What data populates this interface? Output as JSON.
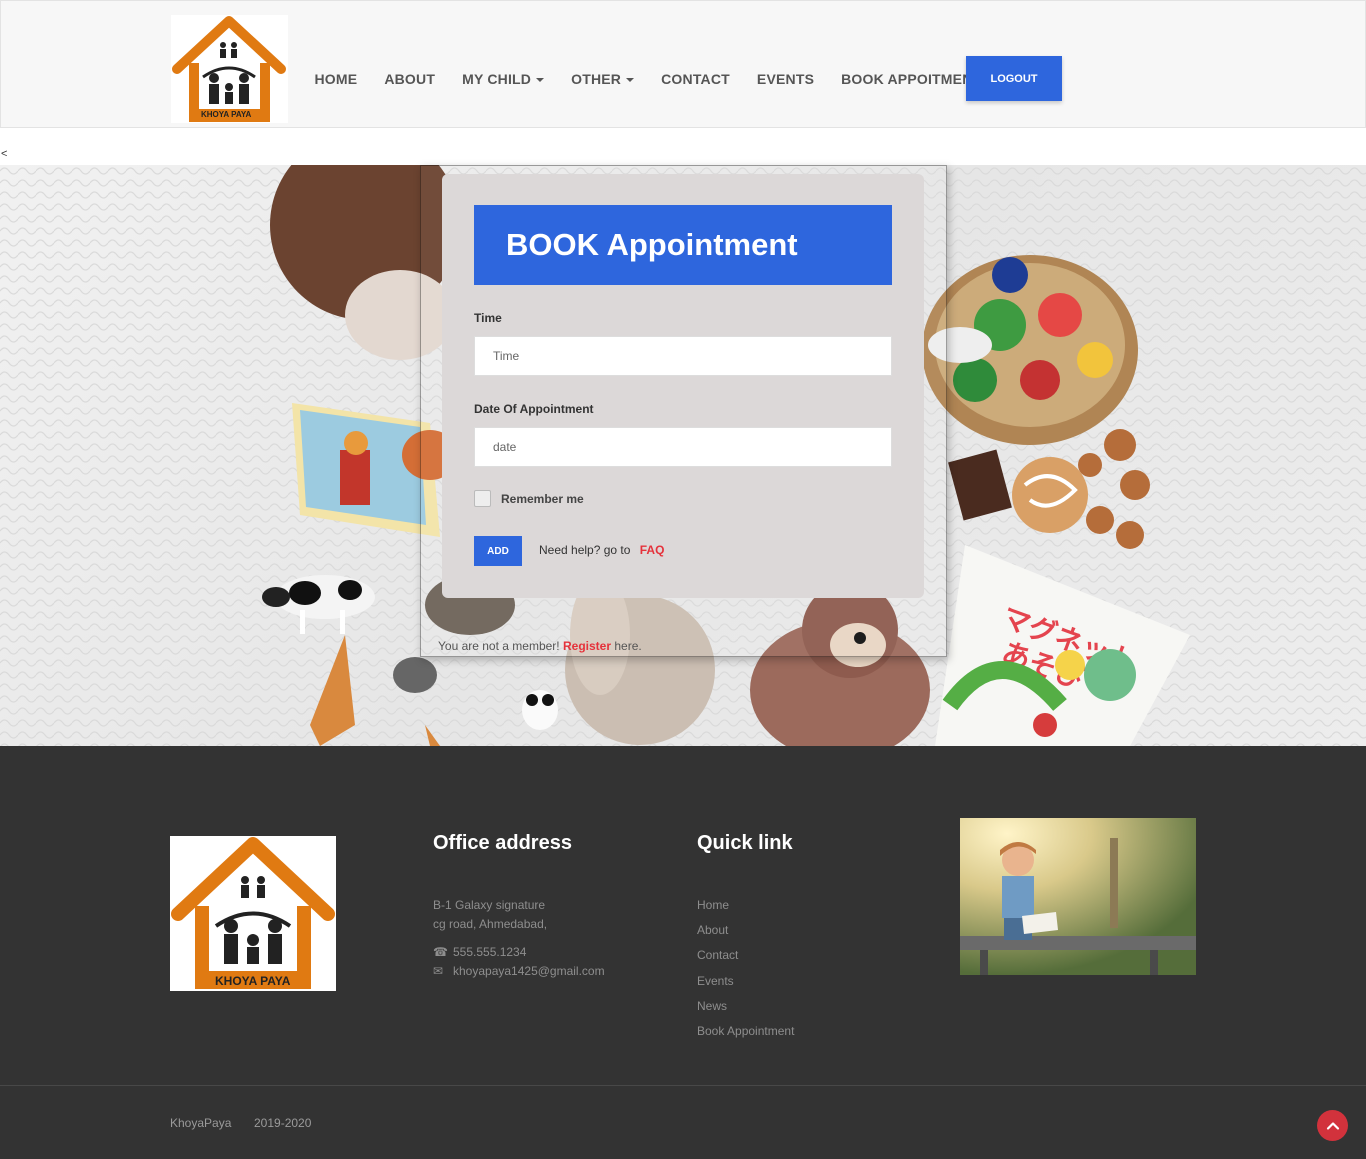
{
  "nav": {
    "logo_text": "KHOYA PAYA",
    "items": [
      {
        "label": "HOME"
      },
      {
        "label": "ABOUT"
      },
      {
        "label": "MY CHILD",
        "dropdown": true
      },
      {
        "label": "OTHER",
        "dropdown": true
      },
      {
        "label": "CONTACT"
      },
      {
        "label": "EVENTS"
      },
      {
        "label": "BOOK APPOITMENT"
      }
    ],
    "logout_label": "LOGOUT"
  },
  "stray_text": "<",
  "form": {
    "title": "BOOK Appointment",
    "time_label": "Time",
    "time_placeholder": "Time",
    "date_label": "Date Of Appointment",
    "date_placeholder": "date",
    "remember_label": "Remember me",
    "remember_checked": false,
    "add_label": "ADD",
    "help_text": "Need help? go to",
    "faq_label": "FAQ"
  },
  "register_line": {
    "prefix": "You are not a member!",
    "link": "Register",
    "suffix": "here."
  },
  "footer": {
    "logo_text": "KHOYA PAYA",
    "office_title": "Office address",
    "address_line1": "B-1 Galaxy signature",
    "address_line2": "cg road, Ahmedabad,",
    "phone_icon": "phone-icon",
    "phone": "555.555.1234",
    "email_icon": "envelope-icon",
    "email": "khoyapaya1425@gmail.com",
    "quick_title": "Quick link",
    "quick_links": [
      "Home",
      "About",
      "Contact",
      "Events",
      "News",
      "Book Appointment"
    ],
    "copyright_name": "KhoyaPaya",
    "copyright_years": "2019-2020",
    "to_top_icon": "chevron-up-icon"
  },
  "colors": {
    "primary": "#2e66dd",
    "accent_red": "#e5323b",
    "footer_bg": "#333333",
    "logo_orange": "#e07a12",
    "card_bg": "#dcd8d8"
  }
}
